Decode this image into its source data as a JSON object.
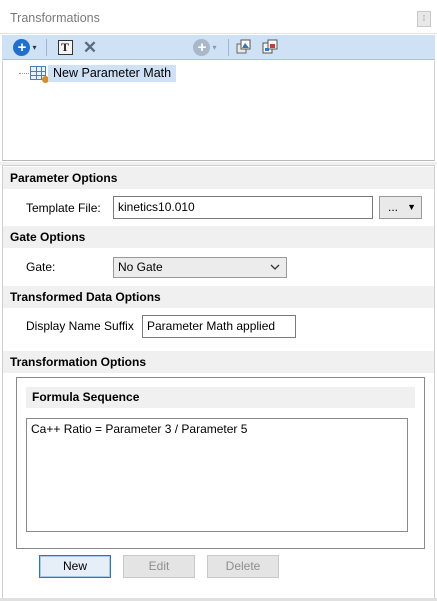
{
  "panel": {
    "title": "Transformations",
    "menu_glyph": "⁞"
  },
  "toolbar": {
    "add_glyph": "+",
    "dropdown_glyph": "▾",
    "template_glyph": "T",
    "delete_glyph": "✕"
  },
  "tree": {
    "nodes": [
      {
        "label": "New Parameter Math"
      }
    ]
  },
  "parameter_options": {
    "heading": "Parameter Options",
    "template_file_label": "Template File:",
    "template_file_value": "kinetics10.010",
    "browse_label": "...",
    "browse_caret": "▼"
  },
  "gate_options": {
    "heading": "Gate Options",
    "gate_label": "Gate:",
    "gate_selected": "No Gate"
  },
  "transformed_data_options": {
    "heading": "Transformed Data Options",
    "suffix_label": "Display Name Suffix",
    "suffix_value": "Parameter Math applied"
  },
  "transformation_options": {
    "heading": "Transformation Options",
    "formula_sequence": {
      "heading": "Formula Sequence",
      "items": [
        "Ca++ Ratio = Parameter 3 / Parameter 5"
      ]
    }
  },
  "buttons": {
    "new": "New",
    "edit": "Edit",
    "delete": "Delete"
  },
  "colors": {
    "toolbar_bg": "#cfe1f5",
    "selection_bg": "#cfe1f5",
    "accent_blue": "#1f6fd0",
    "section_bg": "#f0f0f0"
  }
}
